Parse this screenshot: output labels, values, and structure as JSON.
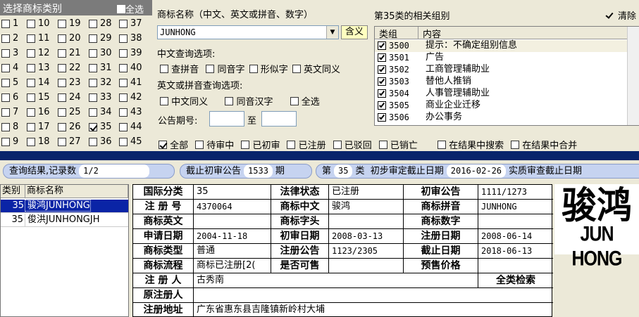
{
  "category_panel": {
    "title": "选择商标类别",
    "select_all": "全选",
    "columns": [
      [
        "1",
        "2",
        "3",
        "4",
        "5",
        "6",
        "7",
        "8",
        "9"
      ],
      [
        "10",
        "11",
        "12",
        "13",
        "14",
        "15",
        "16",
        "17",
        "18"
      ],
      [
        "19",
        "20",
        "21",
        "22",
        "23",
        "24",
        "25",
        "26",
        "27"
      ],
      [
        "28",
        "29",
        "30",
        "31",
        "32",
        "33",
        "34",
        "35",
        "36"
      ],
      [
        "37",
        "38",
        "39",
        "40",
        "41",
        "42",
        "43",
        "44",
        "45"
      ]
    ],
    "checked": [
      "35"
    ]
  },
  "search": {
    "name_label": "商标名称（中文、英文或拼音、数字）",
    "name_value": "JUNHONG",
    "meaning_button": "含义",
    "cn_options_label": "中文查询选项:",
    "cn_options": [
      "查拼音",
      "同音字",
      "形似字",
      "英文同义"
    ],
    "en_options_label": "英文或拼音查询选项:",
    "en_options": [
      "中文同义",
      "同音汉字",
      "全选"
    ],
    "pub_label": "公告期号:",
    "pub_to": "至"
  },
  "group_panel": {
    "title": "第35类的相关组别",
    "clear_label": "清除",
    "headers": [
      "类组",
      "内容"
    ],
    "rows": [
      {
        "code": "3500",
        "text": "提示：不确定组别信息"
      },
      {
        "code": "3501",
        "text": "广告"
      },
      {
        "code": "3502",
        "text": "工商管理辅助业"
      },
      {
        "code": "3503",
        "text": "替他人推销"
      },
      {
        "code": "3504",
        "text": "人事管理辅助业"
      },
      {
        "code": "3505",
        "text": "商业企业迁移"
      },
      {
        "code": "3506",
        "text": "办公事务"
      }
    ]
  },
  "filters": {
    "items": [
      {
        "label": "全部",
        "checked": true
      },
      {
        "label": "待审中",
        "checked": false
      },
      {
        "label": "已初审",
        "checked": false
      },
      {
        "label": "已注册",
        "checked": false
      },
      {
        "label": "已驳回",
        "checked": false
      },
      {
        "label": "已销亡",
        "checked": false
      },
      {
        "label": "在结果中搜索",
        "checked": false
      },
      {
        "label": "在结果中合并",
        "checked": false
      }
    ]
  },
  "status": {
    "result_label": "查询结果,记录数",
    "result_value": "1/2",
    "cutoff_label": "截止初审公告",
    "cutoff_value": "1533",
    "cutoff_unit": "期",
    "class_prefix": "第",
    "class_value": "35",
    "class_suffix": "类",
    "prelim_label": "初步审定截止日期",
    "prelim_value": "2016-02-26",
    "exam_label": "实质审查截止日期"
  },
  "result_list": {
    "headers": [
      "类别",
      "商标名称"
    ],
    "rows": [
      {
        "cls": "35",
        "name": "骏鸿JUNHONG",
        "selected": true
      },
      {
        "cls": "35",
        "name": "俊洪JUNHONGJH",
        "selected": false
      }
    ]
  },
  "detail": {
    "intl_class_label": "国际分类",
    "intl_class": "35",
    "legal_status_label": "法律状态",
    "legal_status": "已注册",
    "prelim_pub_label": "初审公告",
    "prelim_pub": "1111/1273",
    "reg_no_label": "注 册 号",
    "reg_no": "4370064",
    "cn_name_label": "商标中文",
    "cn_name": "骏鸿",
    "pinyin_label": "商标拼音",
    "pinyin": "JUNHONG",
    "en_name_label": "商标英文",
    "en_name": "",
    "initials_label": "商标字头",
    "initials": "",
    "digits_label": "商标数字",
    "digits": "",
    "apply_date_label": "申请日期",
    "apply_date": "2004-11-18",
    "prelim_date_label": "初审日期",
    "prelim_date": "2008-03-13",
    "reg_date_label": "注册日期",
    "reg_date": "2008-06-14",
    "type_label": "商标类型",
    "type": "普通",
    "reg_pub_label": "注册公告",
    "reg_pub": "1123/2305",
    "expiry_label": "截止日期",
    "expiry": "2018-06-13",
    "flow_label": "商标流程",
    "flow": "商标已注册[2(",
    "sellable_label": "是否可售",
    "sellable": "",
    "presale_label": "预售价格",
    "presale": "",
    "registrant_label": "注 册 人",
    "registrant": "古秀南",
    "full_search": "全类检索",
    "orig_registrant_label": "原注册人",
    "orig_registrant": "",
    "address_label": "注册地址",
    "address": "广东省惠东县吉隆镇新岭村大埔"
  },
  "logo": {
    "cn": "骏鸿",
    "en": "JUN HONG"
  }
}
